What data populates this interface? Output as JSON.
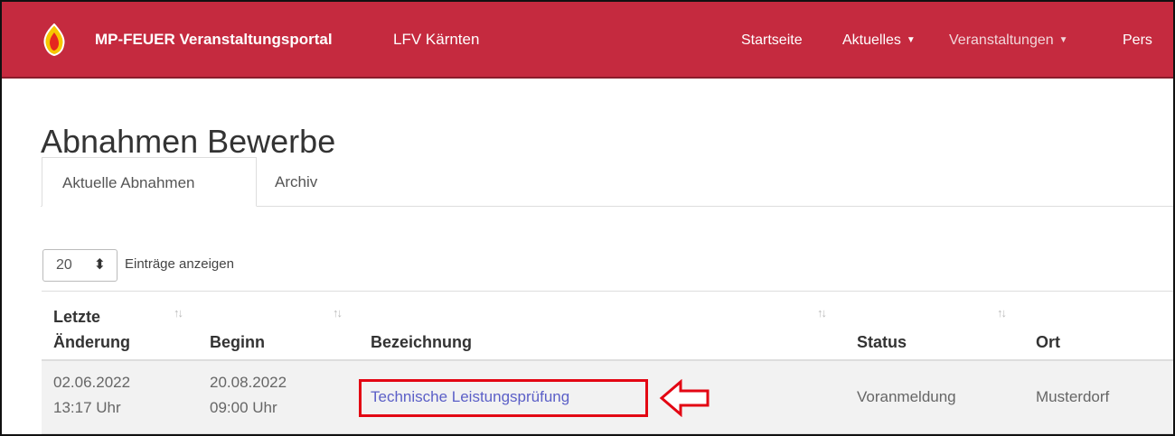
{
  "navbar": {
    "brand": "MP-FEUER Veranstaltungsportal",
    "org": "LFV Kärnten",
    "items": [
      {
        "label": "Startseite"
      },
      {
        "label": "Aktuelles"
      },
      {
        "label": "Veranstaltungen"
      },
      {
        "label": "Pers"
      }
    ],
    "logo_icon": "flame-logo-icon",
    "brand_color": "#c52a3f"
  },
  "page": {
    "title": "Abnahmen Bewerbe",
    "tabs": [
      {
        "label": "Aktuelle Abnahmen",
        "active": true
      },
      {
        "label": "Archiv",
        "active": false
      }
    ]
  },
  "table_controls": {
    "length_value": "20",
    "length_label": "Einträge anzeigen"
  },
  "table": {
    "headers": [
      {
        "line1": "Letzte",
        "line2": "Änderung"
      },
      {
        "line1": "",
        "line2": "Beginn"
      },
      {
        "line1": "",
        "line2": "Bezeichnung"
      },
      {
        "line1": "",
        "line2": "Status"
      },
      {
        "line1": "",
        "line2": "Ort"
      }
    ],
    "rows": [
      {
        "changed_date": "02.06.2022",
        "changed_time": "13:17 Uhr",
        "start_date": "20.08.2022",
        "start_time": "09:00 Uhr",
        "name": "Technische Leistungsprüfung",
        "status": "Voranmeldung",
        "location": "Musterdorf"
      }
    ]
  },
  "annotation": {
    "highlight_color": "#e30613",
    "arrow_icon": "left-arrow-icon"
  }
}
